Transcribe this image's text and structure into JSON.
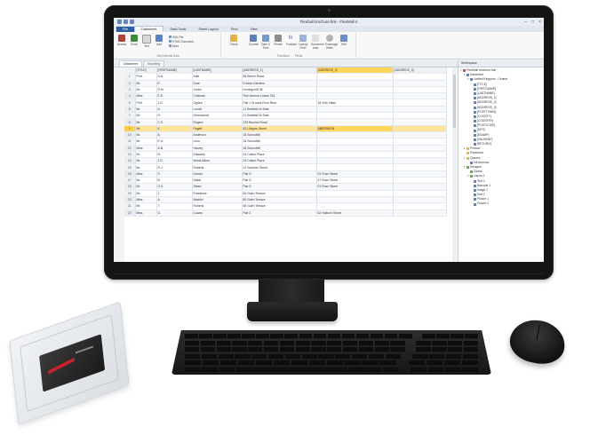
{
  "window": {
    "title": "Flexihall brochure.fmk - FlexiMall 4"
  },
  "ribbon": {
    "tabs": [
      "File",
      "Datasheet",
      "Data Tools",
      "Sheet Layout",
      "Print",
      "View"
    ],
    "active_tab": "Datasheet",
    "group1": {
      "buttons": [
        "Access",
        "Excel",
        "Text",
        "Add"
      ],
      "small": [
        "XML File",
        "HTML Document",
        "More"
      ],
      "label": "Get External Data"
    },
    "group2": {
      "buttons": [
        "Check",
        "Counter",
        "Date & Time",
        "Printer",
        "Function",
        "Lookup Field",
        "Document Auto",
        "Exchange fields",
        "Edit"
      ],
      "label": "Functions",
      "label2": "Fields"
    }
  },
  "doc_tabs": [
    "Datasheet",
    "Incoming"
  ],
  "grid": {
    "columns": [
      "[TITLE]",
      "[FIRSTNAME]",
      "[LASTNAME]",
      "[ADDRESS_1]",
      "[ADDRESS_2]",
      "[ADDRESS_3]"
    ],
    "highlighted_column": "[ADDRESS_2]",
    "selected_row": 9,
    "rows": [
      {
        "n": "1",
        "title": "Prof.",
        "first": "D.A.",
        "last": "Adie",
        "addr1": "55 Beech Road",
        "addr2": ""
      },
      {
        "n": "2",
        "title": "Mr.",
        "first": "E.",
        "last": "Dare",
        "addr1": "9 Adair Gardens",
        "addr2": ""
      },
      {
        "n": "3",
        "title": "Mr.",
        "first": "R.M.",
        "last": "Jones",
        "addr1": "Honingcroft 36",
        "addr2": ""
      },
      {
        "n": "4",
        "title": "Miss",
        "first": "E.E.",
        "last": "Coleman",
        "addr1": "Rue Avenue Louise 324",
        "addr2": ""
      },
      {
        "n": "5",
        "title": "Prof.",
        "first": "J.G.",
        "last": "Ogden",
        "addr1": "Flat 1 Ground Floor Rear",
        "addr2": "18 York Villas"
      },
      {
        "n": "6",
        "title": "Mr.",
        "first": "A.",
        "last": "Lovatt",
        "addr1": "11 Seafield Dr East",
        "addr2": ""
      },
      {
        "n": "7",
        "title": "Mr.",
        "first": "H.",
        "last": "Greenwood",
        "addr1": "11 Seafield Dr East",
        "addr2": ""
      },
      {
        "n": "8",
        "title": "Mr.",
        "first": "C.E.",
        "last": "Rogers",
        "addr1": "125 Buchan Road",
        "addr2": ""
      },
      {
        "n": "9",
        "title": "Mr.",
        "first": "K.",
        "last": "Pagett",
        "addr1": "81 Lithgow Street",
        "addr2": "ABERDEEN"
      },
      {
        "n": "10",
        "title": "Mr.",
        "first": "A.",
        "last": "Anderson",
        "addr1": "18 Schoolhill",
        "addr2": ""
      },
      {
        "n": "11",
        "title": "Mr.",
        "first": "E.G.",
        "last": "Leon",
        "addr1": "18 Schoolhill",
        "addr2": ""
      },
      {
        "n": "12",
        "title": "Miss",
        "first": "A.B.",
        "last": "Harvey",
        "addr1": "18 Schoolhill",
        "addr2": ""
      },
      {
        "n": "13",
        "title": "Mr.",
        "first": "N.",
        "last": "Edwards",
        "addr1": "24 Cotton Place",
        "addr2": ""
      },
      {
        "n": "14",
        "title": "Mr.",
        "first": "J.G.",
        "last": "Wood-Allum",
        "addr1": "24 Cotton Place",
        "addr2": ""
      },
      {
        "n": "15",
        "title": "Mr.",
        "first": "R.J.",
        "last": "Roberts",
        "addr1": "24 Summer Street",
        "addr2": ""
      },
      {
        "n": "16",
        "title": "Miss",
        "first": "S.",
        "last": "Garnet",
        "addr1": "Flat G",
        "addr2": "51 Rose Street"
      },
      {
        "n": "17",
        "title": "Mr.",
        "first": "B.",
        "last": "Wade",
        "addr1": "Flat G",
        "addr2": "47 Rose Street"
      },
      {
        "n": "18",
        "title": "Mr.",
        "first": "G.E.",
        "last": "Steed",
        "addr1": "Flat G",
        "addr2": "51 Rose Street"
      },
      {
        "n": "19",
        "title": "Mr.",
        "first": "J.",
        "last": "Freestone",
        "addr1": "60 Gairn Terrace",
        "addr2": ""
      },
      {
        "n": "20",
        "title": "Miss",
        "first": "A.",
        "last": "Maddin",
        "addr1": "60 Gairn Terrace",
        "addr2": ""
      },
      {
        "n": "21",
        "title": "Mr.",
        "first": "T.",
        "last": "Roberts",
        "addr1": "65 Gairn Terrace",
        "addr2": ""
      },
      {
        "n": "22",
        "title": "Miss",
        "first": "G.",
        "last": "Cowan",
        "addr1": "Flat 3",
        "addr2": "62 Holburn Street"
      }
    ]
  },
  "panel": {
    "title": "Workspace",
    "tree": [
      {
        "lvl": 0,
        "t": "FlexiMall brochure.fmk",
        "i": "r",
        "e": "-"
      },
      {
        "lvl": 1,
        "t": "Datasheet",
        "i": "b",
        "e": "-"
      },
      {
        "lvl": 2,
        "t": "Limited Kingdom - Central",
        "i": "b",
        "e": "-"
      },
      {
        "lvl": 3,
        "t": "[TITLE]",
        "i": "b",
        "e": ""
      },
      {
        "lvl": 3,
        "t": "[FIRSTNAME]",
        "i": "b",
        "e": ""
      },
      {
        "lvl": 3,
        "t": "[LASTNAME]",
        "i": "b",
        "e": ""
      },
      {
        "lvl": 3,
        "t": "[ADDRESS_1]",
        "i": "b",
        "e": ""
      },
      {
        "lvl": 3,
        "t": "[ADDRESS_2]",
        "i": "b",
        "e": ""
      },
      {
        "lvl": 3,
        "t": "[ADDRESS_3]",
        "i": "b",
        "e": ""
      },
      {
        "lvl": 3,
        "t": "[POSTTOWN]",
        "i": "b",
        "e": ""
      },
      {
        "lvl": 3,
        "t": "[COUNTY]",
        "i": "b",
        "e": ""
      },
      {
        "lvl": 3,
        "t": "[COUNTRY]",
        "i": "b",
        "e": ""
      },
      {
        "lvl": 3,
        "t": "[POSTCODE]",
        "i": "b",
        "e": ""
      },
      {
        "lvl": 3,
        "t": "[DPS]",
        "i": "b",
        "e": ""
      },
      {
        "lvl": 3,
        "t": "[SSAMP]",
        "i": "b",
        "e": ""
      },
      {
        "lvl": 3,
        "t": "[VALIDPAF]",
        "i": "b",
        "e": ""
      },
      {
        "lvl": 3,
        "t": "[RETURN]",
        "i": "b",
        "e": ""
      },
      {
        "lvl": 1,
        "t": "Product",
        "i": "f",
        "e": "+"
      },
      {
        "lvl": 1,
        "t": "Planchard",
        "i": "f",
        "e": ""
      },
      {
        "lvl": 1,
        "t": "Queries",
        "i": "f",
        "e": "-"
      },
      {
        "lvl": 2,
        "t": "Init Amendo",
        "i": "b",
        "e": ""
      },
      {
        "lvl": 1,
        "t": "Designer",
        "i": "g",
        "e": "-"
      },
      {
        "lvl": 2,
        "t": "Global",
        "i": "g",
        "e": ""
      },
      {
        "lvl": 2,
        "t": "Layout 1",
        "i": "g",
        "e": "-"
      },
      {
        "lvl": 3,
        "t": "Text 1",
        "i": "b",
        "e": ""
      },
      {
        "lvl": 3,
        "t": "Barcode 1",
        "i": "b",
        "e": ""
      },
      {
        "lvl": 3,
        "t": "Image 1",
        "i": "b",
        "e": ""
      },
      {
        "lvl": 3,
        "t": "Text 2",
        "i": "b",
        "e": ""
      },
      {
        "lvl": 3,
        "t": "Picture 1",
        "i": "b",
        "e": ""
      },
      {
        "lvl": 3,
        "t": "Picture 2",
        "i": "b",
        "e": ""
      }
    ]
  }
}
